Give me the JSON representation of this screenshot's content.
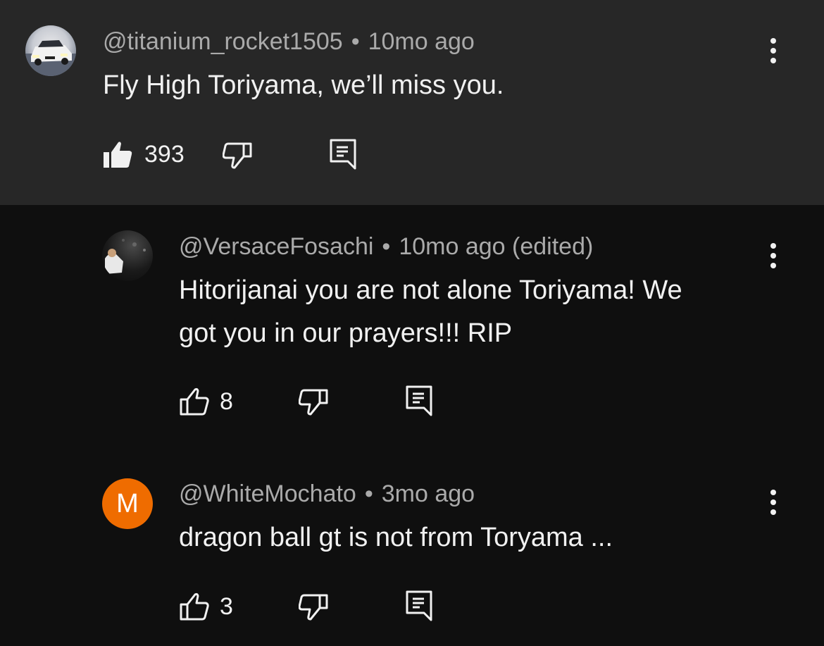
{
  "comments": [
    {
      "author": "@titanium_rocket1505",
      "separator": "•",
      "time": "10mo ago",
      "edited": "",
      "text_lines": [
        "Fly High Toriyama, we’ll miss you."
      ],
      "likes": "393",
      "liked": true,
      "avatar_icon": "car-photo-avatar"
    },
    {
      "author": "@VersaceFosachi",
      "separator": "•",
      "time": "10mo ago",
      "edited": "(edited)",
      "text_lines": [
        "Hitorijanai you are not alone Toriyama! We",
        "got you in our prayers!!! RIP"
      ],
      "likes": "8",
      "liked": false,
      "avatar_icon": "person-photo-avatar"
    },
    {
      "author": "@WhiteMochato",
      "separator": "•",
      "time": "3mo ago",
      "edited": "",
      "text_lines": [
        "dragon ball gt is not from Toryama ..."
      ],
      "likes": "3",
      "liked": false,
      "avatar_letter": "M",
      "avatar_color": "#ef6c00"
    }
  ],
  "colors": {
    "highlight_bg": "#272727",
    "page_bg": "#0f0f0f",
    "meta_text": "#aaaaaa",
    "primary_text": "#f1f1f1"
  },
  "icons": [
    "thumbs-up-icon",
    "thumbs-down-icon",
    "reply-icon",
    "more-vert-icon"
  ]
}
